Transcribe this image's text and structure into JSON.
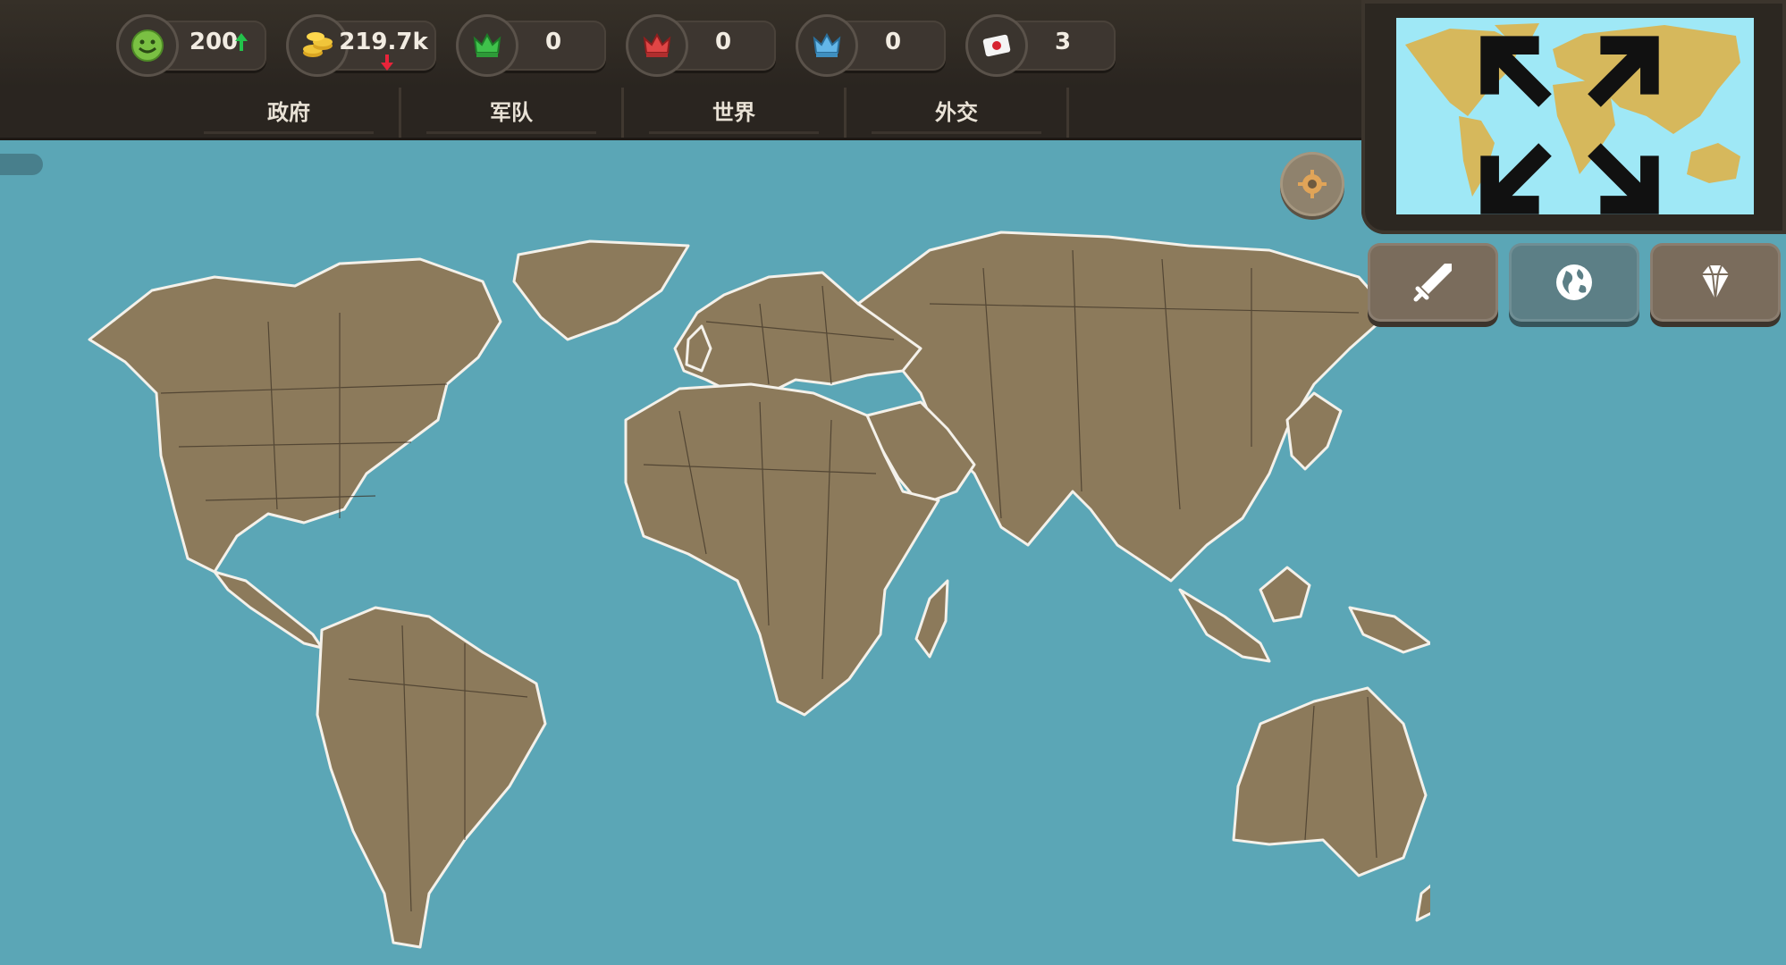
{
  "resources": [
    {
      "name": "happiness",
      "value": "200",
      "trend": "up"
    },
    {
      "name": "money",
      "value": "219.7k",
      "trend": "down"
    },
    {
      "name": "green-crown",
      "value": "0"
    },
    {
      "name": "red-crown",
      "value": "0"
    },
    {
      "name": "blue-crown",
      "value": "0"
    },
    {
      "name": "flag",
      "value": "3"
    }
  ],
  "tabs": [
    "政府",
    "军队",
    "世界",
    "外交"
  ],
  "actions": [
    {
      "icon": "sword-icon"
    },
    {
      "icon": "globe-icon"
    },
    {
      "icon": "diamond-icon"
    }
  ],
  "colors": {
    "ocean": "#5ba6b6",
    "land": "#8c7a5b",
    "minimap_ocean": "#9fe8f6",
    "minimap_land": "#d6b85c",
    "bar": "#2a2520"
  }
}
